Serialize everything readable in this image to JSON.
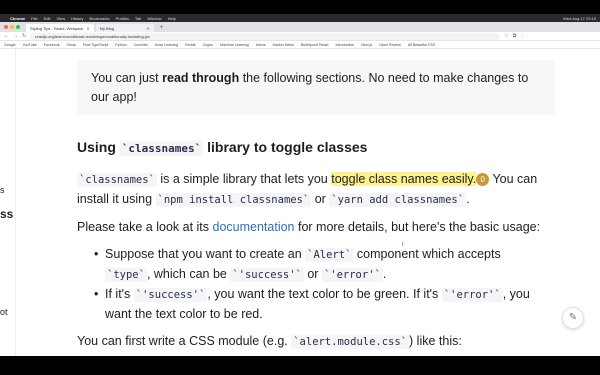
{
  "menubar": {
    "app": "Chrome",
    "items": [
      "File",
      "Edit",
      "View",
      "History",
      "Bookmarks",
      "Profiles",
      "Tab",
      "Window",
      "Help"
    ],
    "clock": "Wed Aug 17  23:10"
  },
  "tabs": [
    {
      "label": "Styling Tips - React, Webpack"
    },
    {
      "label": "My Blog"
    }
  ],
  "address": {
    "url": "reactjs.org/learn/conditional-rendering#conditionally-including-jsx"
  },
  "bookmarks": [
    "Google",
    "YouTube",
    "Facebook",
    "Gmail",
    "Flow TypeScript",
    "Python",
    "ConvNet",
    "Deep Learning",
    "Reddit",
    "Crypto",
    "Machine Learning",
    "Aliens",
    "Hacker News",
    "Bulletproof React",
    "Introduction",
    "Next.js",
    "Open Review",
    "All Beautiful CSS"
  ],
  "sidebar_fragments": {
    "a": "s",
    "b": "ss",
    "c": "ot"
  },
  "note": {
    "pre": "You can just ",
    "bold": "read through",
    "post": " the following sections. No need to make changes to our app!"
  },
  "section": {
    "pre": "Using ",
    "code": "`classnames`",
    "post": " library to toggle classes"
  },
  "p1": {
    "code1": "`classnames`",
    "t1": " is a simple library that lets you ",
    "highlight": "toggle class names easily.",
    "badge": "0",
    "t2": " You can install it using ",
    "code2": "`npm install classnames`",
    "t3": " or ",
    "code3": "`yarn add classnames`",
    "t4": "."
  },
  "p2": {
    "t1": "Please take a look at its ",
    "link": "documentation",
    "t2": " for more details, but here's the basic usage:"
  },
  "bullet1": {
    "t1": "Suppose that you want to create an ",
    "code1": "`Alert`",
    "t2": " component which accepts ",
    "code2": "`type`",
    "t3": ", which can be ",
    "code3": "`'success'`",
    "t4": " or ",
    "code4": "`'error'`",
    "t5": "."
  },
  "bullet2": {
    "t1": "If it's ",
    "code1": "`'success'`",
    "t2": ", you want the text color to be green. If it's ",
    "code2": "`'error'`",
    "t3": ", you want the text color to be red."
  },
  "p3": {
    "t1": "You can first write a CSS module (e.g. ",
    "code1": "`alert.module.css`",
    "t2": ") like this:"
  },
  "icons": {
    "float_button": "pencil-icon"
  }
}
